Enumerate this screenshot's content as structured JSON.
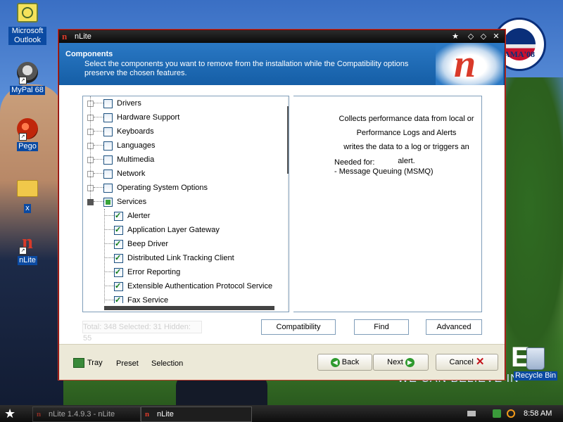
{
  "desktop": {
    "icons": [
      {
        "label": "Microsoft Outlook",
        "icon": "outlook-icon"
      },
      {
        "label": "MyPal 68",
        "icon": "mypal-icon"
      },
      {
        "label": "Pego",
        "icon": "pego-icon"
      },
      {
        "label": "x",
        "icon": "folder-icon"
      },
      {
        "label": "nLite",
        "icon": "nlite-icon"
      }
    ],
    "recycle_bin": "Recycle Bin",
    "wallpaper": {
      "logo_text": "AMA'08",
      "slogan": "WE CAN BELIEVE IN",
      "letter": "E"
    }
  },
  "window": {
    "title": "nLite",
    "title_buttons": [
      "star-icon",
      "pin-icon",
      "pin-icon",
      "close-icon"
    ],
    "header": {
      "title": "Components",
      "description": "Select the components you want to remove from the installation while the Compatibility options preserve the chosen features."
    },
    "tree": {
      "categories": [
        {
          "label": "Drivers",
          "state": "unchecked"
        },
        {
          "label": "Hardware Support",
          "state": "unchecked"
        },
        {
          "label": "Keyboards",
          "state": "unchecked"
        },
        {
          "label": "Languages",
          "state": "unchecked"
        },
        {
          "label": "Multimedia",
          "state": "unchecked"
        },
        {
          "label": "Network",
          "state": "unchecked"
        },
        {
          "label": "Operating System Options",
          "state": "unchecked"
        },
        {
          "label": "Services",
          "state": "partial",
          "expanded": true
        }
      ],
      "services": [
        {
          "label": "Alerter",
          "checked": true
        },
        {
          "label": "Application Layer Gateway",
          "checked": true
        },
        {
          "label": "Beep Driver",
          "checked": true
        },
        {
          "label": "Distributed Link Tracking Client",
          "checked": true
        },
        {
          "label": "Error Reporting",
          "checked": true
        },
        {
          "label": "Extensible Authentication Protocol Service",
          "checked": true
        },
        {
          "label": "Fax Service",
          "checked": true
        }
      ]
    },
    "info": {
      "line1": "Collects performance data from local or",
      "line2": "Performance Logs and Alerts",
      "line3": "writes the data to a log or triggers an alert.",
      "needed_label": "Needed for:",
      "needed_item": "- Message Queuing (MSMQ)"
    },
    "status": "Total: 348 Selected: 31 Hidden: 55",
    "tabs": {
      "compatibility": "Compatibility",
      "find": "Find",
      "advanced": "Advanced"
    },
    "footer": {
      "tray": "Tray",
      "preset": "Preset",
      "selection": "Selection",
      "back": "Back",
      "next": "Next",
      "cancel": "Cancel"
    }
  },
  "taskbar": {
    "tasks": [
      "nLite 1.4.9.3 - nLite",
      "nLite"
    ],
    "clock": "8:58 AM"
  },
  "colors": {
    "header_blue": "#1f6bb8",
    "titlebar": "#151515",
    "accent_red": "#c3121a",
    "check_green": "#0c7a12"
  }
}
